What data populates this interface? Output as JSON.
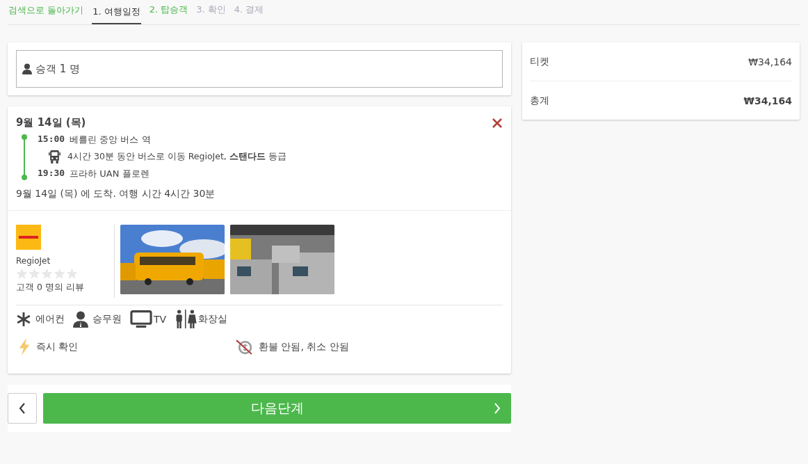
{
  "nav": {
    "back_link": "검색으로 돌아가기",
    "steps": [
      {
        "label": "1. 여행일정",
        "selected": true,
        "available": true
      },
      {
        "label": "2. 탑승객",
        "selected": false,
        "available": true
      },
      {
        "label": "3. 확인",
        "selected": false,
        "available": false
      },
      {
        "label": "4. 결제",
        "selected": false,
        "available": false
      }
    ]
  },
  "passengers": {
    "value": "승객 1 명"
  },
  "trip": {
    "date": "9월 14일 (목)",
    "departure": {
      "time": "15:00",
      "place": "베를린 중앙 버스 역"
    },
    "segment": "4시간 30분 동안 버스로 이동 RegioJet, **스탠다드** 등급",
    "arrival": {
      "time": "19:30",
      "place": "프라하 UAN 플로렌"
    },
    "summary": "9월 14일 (목) 에 도착. 여행 시간 4시간 30분",
    "operator": {
      "name": "RegioJet",
      "stars": 0,
      "reviews": "고객 0 명의 리뷰"
    },
    "amenities": [
      {
        "kind": "ac",
        "label": "에어컨"
      },
      {
        "kind": "attendant",
        "label": "승무원"
      },
      {
        "kind": "tv",
        "label": "TV"
      },
      {
        "kind": "toilet",
        "label": "화장실"
      }
    ],
    "policies": [
      {
        "kind": "instant",
        "label": "즉시 확인"
      },
      {
        "kind": "no_refund",
        "label": "환불 안됨, 취소 안됨"
      }
    ]
  },
  "summary": {
    "rows": [
      {
        "label": "티켓",
        "value": "₩34,164",
        "total": false
      },
      {
        "label": "총계",
        "value": "₩34,164",
        "total": true
      }
    ]
  },
  "footer": {
    "next_button": "다음단계"
  }
}
